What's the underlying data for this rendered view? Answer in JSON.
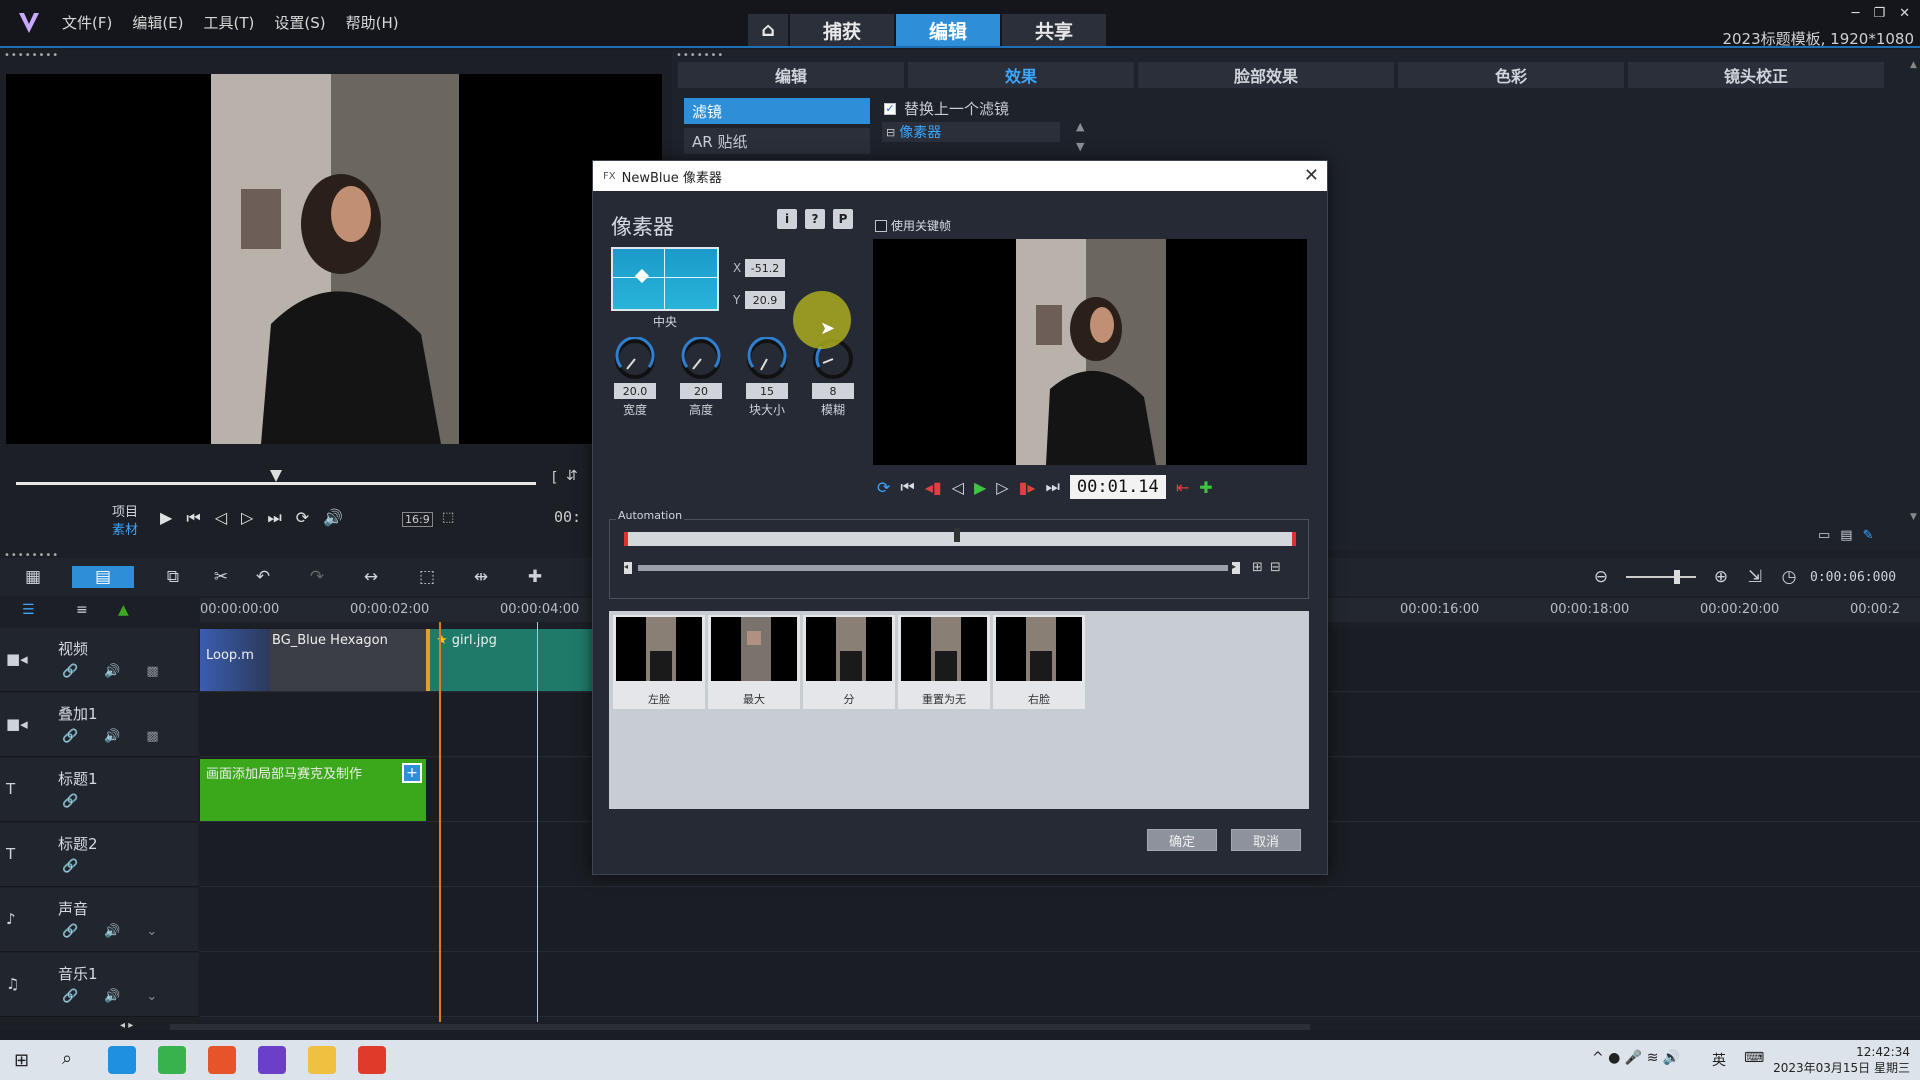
{
  "menu": [
    "文件(F)",
    "编辑(E)",
    "工具(T)",
    "设置(S)",
    "帮助(H)"
  ],
  "mode_tabs": [
    "捕获",
    "编辑",
    "共享"
  ],
  "project_info": "2023标题模板, 1920*1080",
  "preview": {
    "project_label": "项目",
    "clip_label": "素材",
    "aspect": "16:9",
    "timecode_partial": "00:"
  },
  "effect_tabs": [
    "编辑",
    "效果",
    "脸部效果",
    "色彩",
    "镜头校正"
  ],
  "effect_categories": [
    "滤镜",
    "AR 贴纸"
  ],
  "replace_filter": "替换上一个滤镜",
  "applied_filter": "像素器",
  "dialog": {
    "title": "NewBlue 像素器",
    "plugin_name": "像素器",
    "info_buttons": [
      "i",
      "?",
      "P"
    ],
    "position_label": "中央",
    "x_label": "X",
    "x_value": "-51.2",
    "y_label": "Y",
    "y_value": "20.9",
    "knobs": [
      {
        "label": "宽度",
        "value": "20.0"
      },
      {
        "label": "高度",
        "value": "20"
      },
      {
        "label": "块大小",
        "value": "15"
      },
      {
        "label": "模糊",
        "value": "8"
      }
    ],
    "keyframe_label": "使用关键帧",
    "timecode": "00:01.14",
    "automation_label": "Automation",
    "presets": [
      "左脸",
      "最大",
      "分",
      "重置为无",
      "右脸"
    ],
    "ok": "确定",
    "cancel": "取消"
  },
  "timeline": {
    "duration": "0:00:06:000",
    "ruler_labels": [
      "00:00:00:00",
      "00:00:02:00",
      "00:00:04:00",
      "00:00:16:00",
      "00:00:18:00",
      "00:00:20:00",
      "00:00:2"
    ],
    "tracks": [
      {
        "name": "视频"
      },
      {
        "name": "叠加1"
      },
      {
        "name": "标题1"
      },
      {
        "name": "标题2"
      },
      {
        "name": "声音"
      },
      {
        "name": "音乐1"
      }
    ],
    "clips": {
      "bg_clip": "BG_Blue Hexagon Loop.m",
      "girl_clip": "girl.jpg",
      "title_clip": "画面添加局部马赛克及制作"
    }
  },
  "taskbar": {
    "time": "12:42:34",
    "date": "2023年03月15日 星期三",
    "lang": "英"
  },
  "colors": {
    "accent": "#2e8fd8",
    "title_clip": "#3aa81a",
    "video_clip": "#1f7a6a"
  }
}
